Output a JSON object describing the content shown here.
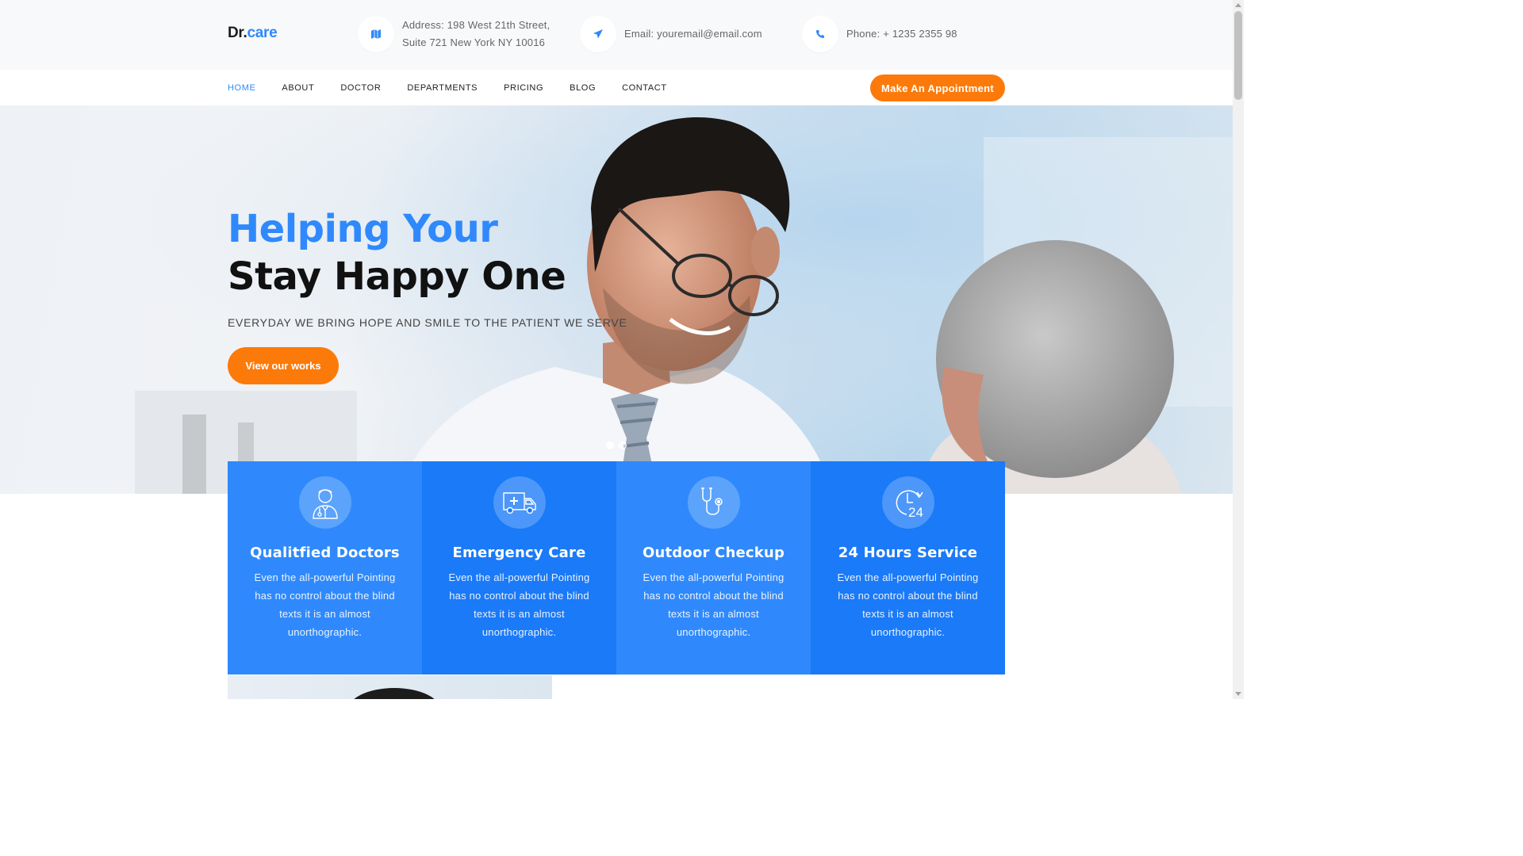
{
  "brand": {
    "prefix": "Dr.",
    "suffix": "care"
  },
  "contact": {
    "address_line1": "Address: 198 West 21th Street,",
    "address_line2": "Suite 721 New York NY 10016",
    "email": "Email: youremail@email.com",
    "phone": "Phone: + 1235 2355 98"
  },
  "nav": {
    "items": [
      "HOME",
      "ABOUT",
      "DOCTOR",
      "DEPARTMENTS",
      "PRICING",
      "BLOG",
      "CONTACT"
    ],
    "active": "HOME",
    "cta": "Make An Appointment"
  },
  "hero": {
    "title_line1": "Helping Your",
    "title_line2": "Stay Happy One",
    "subtitle": "EVERYDAY WE BRING HOPE AND SMILE TO THE PATIENT WE SERVE",
    "button": "View our works",
    "slides": 2,
    "active_slide": 1
  },
  "services": [
    {
      "icon": "doctor-icon",
      "title": "Qualitfied Doctors",
      "text": "Even the all-powerful Pointing has no control about the blind texts it is an almost unorthographic."
    },
    {
      "icon": "ambulance-icon",
      "title": "Emergency Care",
      "text": "Even the all-powerful Pointing has no control about the blind texts it is an almost unorthographic."
    },
    {
      "icon": "stethoscope-icon",
      "title": "Outdoor Checkup",
      "text": "Even the all-powerful Pointing has no control about the blind texts it is an almost unorthographic."
    },
    {
      "icon": "clock-24-icon",
      "title": "24 Hours Service",
      "text": "Even the all-powerful Pointing has no control about the blind texts it is an almost unorthographic."
    }
  ],
  "colors": {
    "primary": "#2f89fc",
    "accent": "#fc7a0a",
    "dark": "#111111"
  }
}
